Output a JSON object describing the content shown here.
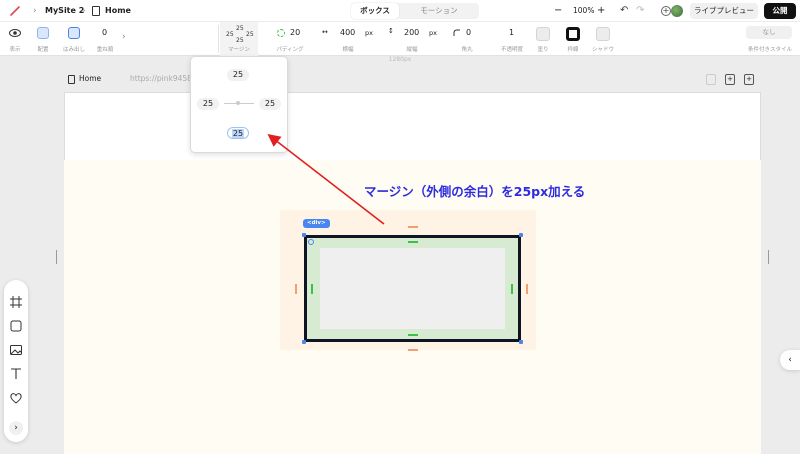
{
  "topbar": {
    "chevron": "›",
    "site_name": "MySite 2",
    "page_name": "Home",
    "tabs": [
      {
        "label": "ボックス",
        "active": true
      },
      {
        "label": "モーション",
        "active": false
      }
    ],
    "zoom_minus": "−",
    "zoom": "100%",
    "zoom_plus": "+",
    "undo": "↶",
    "redo": "↷",
    "add": "+",
    "live_preview": "ライブプレビュー",
    "publish": "公開"
  },
  "toolbar": {
    "show_label": "表示",
    "align_label": "配置",
    "overflow_label": "はみ出し",
    "zindex_value": "0",
    "zindex_label": "重ね順",
    "chevron": "›",
    "margin": {
      "top": "25",
      "left": "25",
      "right": "25",
      "bottom": "25",
      "label": "マージン"
    },
    "padding": {
      "value": "20",
      "label": "パディング"
    },
    "width": {
      "value": "400",
      "unit": "px",
      "label": "横幅"
    },
    "height": {
      "value": "200",
      "unit": "px",
      "label": "縦幅"
    },
    "radius": {
      "value": "0",
      "label": "角丸"
    },
    "opacity": {
      "value": "1",
      "label": "不透明度"
    },
    "fill_label": "塗り",
    "border_label": "枠線",
    "shadow_label": "シャドウ",
    "conditional": {
      "value": "なし",
      "label": "条件付きスタイル"
    }
  },
  "ruler_label": "1280px",
  "pagebar": {
    "page_name": "Home",
    "url": "https://pink94580"
  },
  "popup": {
    "top": "25",
    "left": "25",
    "right": "25",
    "bottom": "25"
  },
  "element_tag": "<div>",
  "annotation": "マージン（外側の余白）を25px加える",
  "dock": {
    "items": [
      "frame-icon",
      "rectangle-icon",
      "image-icon",
      "text-icon",
      "heart-icon"
    ],
    "more": "›"
  },
  "right_toggle": "‹",
  "colors": {
    "accent": "#4a86f0",
    "annotation": "#2d2be0",
    "arrow": "#e02020",
    "margin": "#f0a070",
    "padding": "#3cc04a"
  }
}
